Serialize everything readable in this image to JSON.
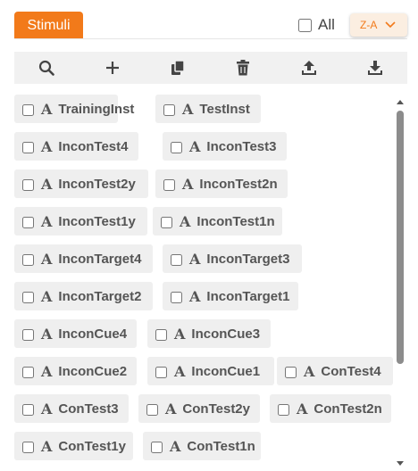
{
  "header": {
    "tab_label": "Stimuli",
    "all_label": "All",
    "sort_label": "Z-A"
  },
  "toolbar": {
    "icons": [
      "search-icon",
      "plus-icon",
      "copy-icon",
      "trash-icon",
      "upload-icon",
      "download-icon"
    ]
  },
  "colors": {
    "accent": "#f27a1a",
    "chip_bg": "#efefef",
    "toolbar_bg": "#f1f1f1"
  },
  "items": [
    "TrainingInst",
    "TestInst",
    "InconTest4",
    "InconTest3",
    "InconTest2y",
    "InconTest2n",
    "InconTest1y",
    "InconTest1n",
    "InconTarget4",
    "InconTarget3",
    "InconTarget2",
    "InconTarget1",
    "InconCue4",
    "InconCue3",
    "InconCue2",
    "InconCue1",
    "ConTest4",
    "ConTest3",
    "ConTest2y",
    "ConTest2n",
    "ConTest1y",
    "ConTest1n"
  ]
}
